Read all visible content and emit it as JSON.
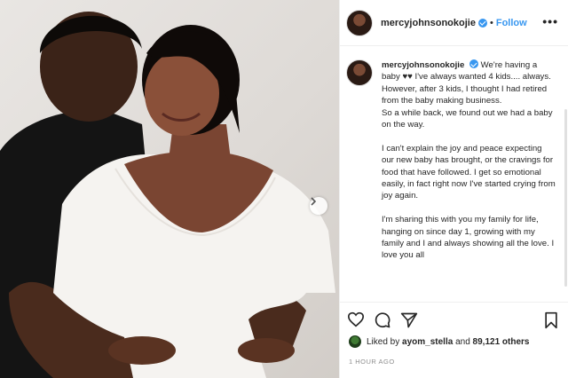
{
  "post": {
    "username": "mercyjohnsonokojie",
    "separator": "•",
    "follow_label": "Follow",
    "more_icon": "more-options-icon",
    "caption_paragraphs": [
      "We're having a baby ♥♥ I've always wanted 4 kids.... always. However, after 3 kids, I thought I had retired from the baby making business.",
      "So a while back, we found out we had a baby on the way.",
      "I can't explain the joy and peace expecting our new baby has brought, or the cravings for food that have followed. I get so emotional easily, in fact right now I've started crying from joy again.",
      "I'm sharing this with you my family for life, hanging on since day 1, growing with my family and I and always showing all the love. I love you all"
    ],
    "likes": {
      "prefix": "Liked by",
      "user": "ayom_stella",
      "joiner": "and",
      "count": "89,121 others"
    },
    "timestamp": "1 HOUR AGO"
  },
  "colors": {
    "accent": "#3897f0",
    "text": "#262626",
    "muted": "#8e8e8e"
  },
  "icons": [
    "heart-icon",
    "comment-icon",
    "share-icon",
    "bookmark-icon",
    "chevron-right-icon",
    "verified-badge-icon"
  ]
}
